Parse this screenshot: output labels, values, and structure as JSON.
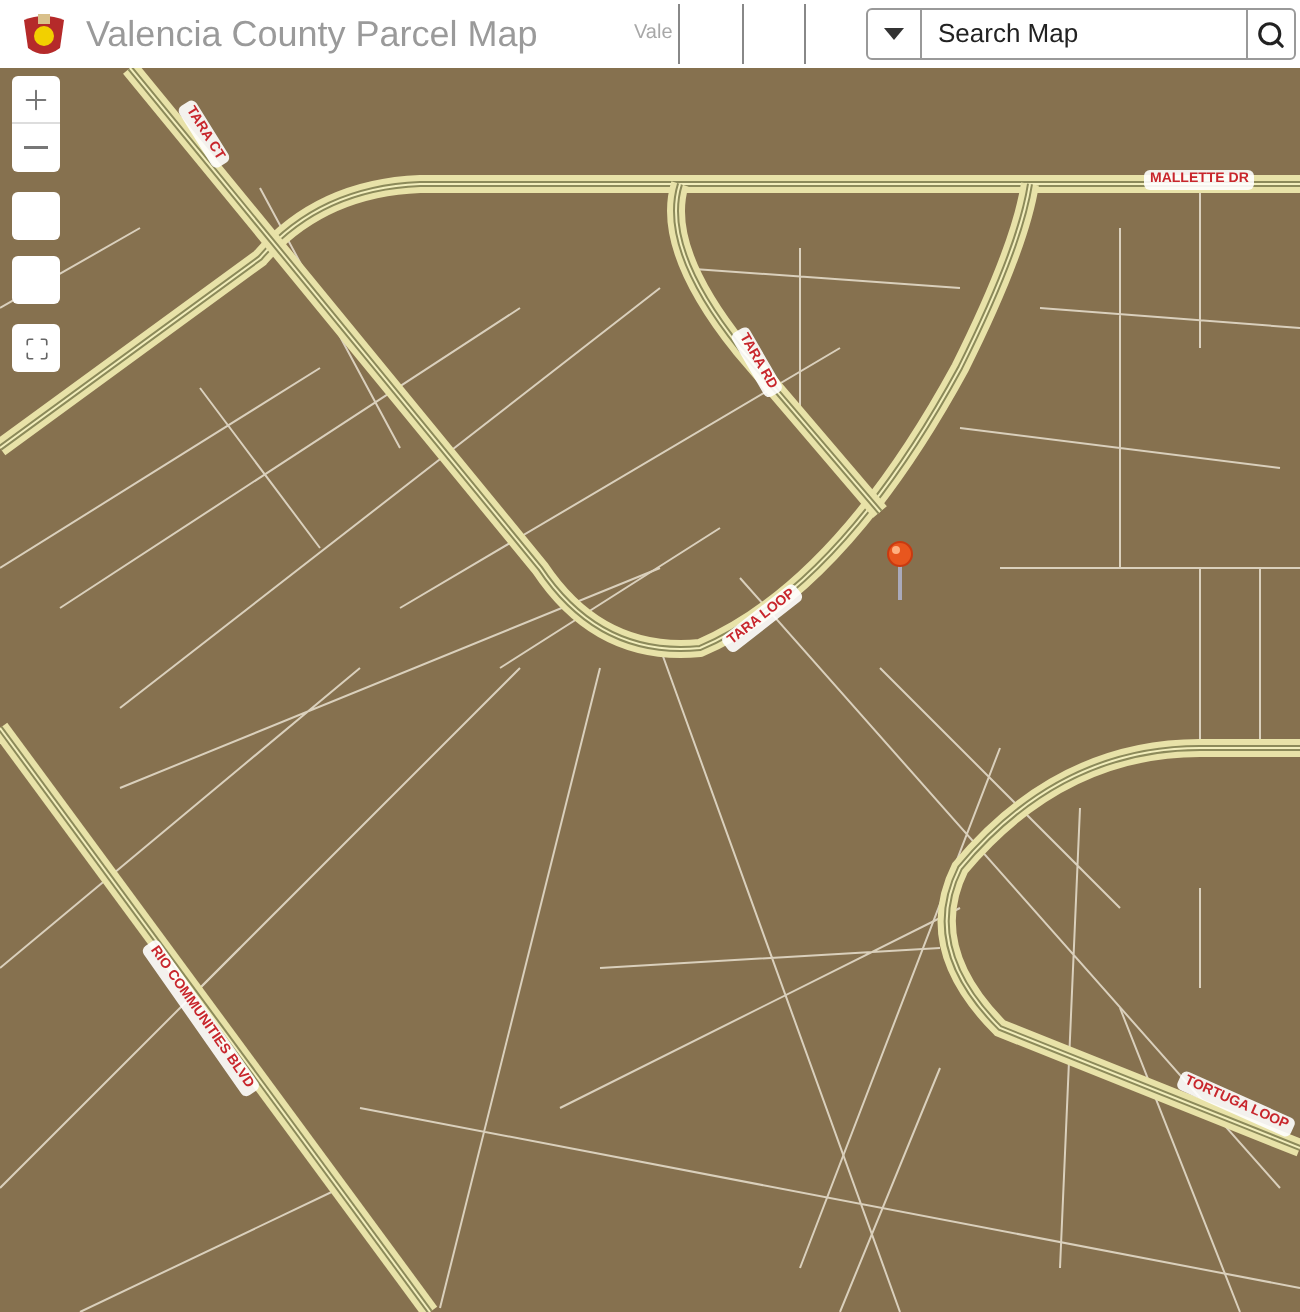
{
  "header": {
    "title": "Valencia County Parcel Map",
    "hidden_tab": "Vale"
  },
  "search": {
    "placeholder": "Search Map"
  },
  "road_labels": [
    {
      "text": "TARA CT"
    },
    {
      "text": "MALLETTE DR"
    },
    {
      "text": "TARA RD"
    },
    {
      "text": "TARA LOOP"
    },
    {
      "text": "RIO COMMUNITIES BLVD"
    },
    {
      "text": "TORTUGA LOOP"
    }
  ]
}
